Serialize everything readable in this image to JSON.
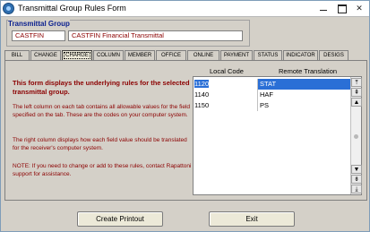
{
  "window": {
    "title": "Transmittal Group Rules Form"
  },
  "group": {
    "title": "Transmittal Group",
    "code": "CASTFIN",
    "name": "CASTFIN Financial Transmittal"
  },
  "tabs": [
    {
      "label": "BILL"
    },
    {
      "label": "CHANGE"
    },
    {
      "label": "CHARGE",
      "active": true
    },
    {
      "label": "COLUMN"
    },
    {
      "label": "MEMBER"
    },
    {
      "label": "OFFICE"
    },
    {
      "label": "ONLINE"
    },
    {
      "label": "PAYMENT"
    },
    {
      "label": "STATUS"
    },
    {
      "label": "INDICATOR"
    },
    {
      "label": "DESIGS"
    }
  ],
  "info": {
    "heading": "This form displays the underlying rules for the selected transmittal group.",
    "p1": "The left column on each tab contains all allowable values for the field specified on the tab. These are the codes on your computer system.",
    "p2": "The right column displays how each field value should be translated for the receiver's computer system.",
    "p3": "NOTE: If you need to change or add to these rules, contact Rapattoni support for assistance."
  },
  "grid": {
    "headers": {
      "local": "Local Code",
      "remote": "Remote Translation"
    },
    "rows": [
      {
        "local": "1120",
        "remote": "STAT",
        "selected": true
      },
      {
        "local": "1140",
        "remote": "HAF"
      },
      {
        "local": "1150",
        "remote": "PS"
      }
    ]
  },
  "buttons": {
    "print": "Create Printout",
    "exit": "Exit"
  },
  "icons": {
    "app": "app-icon",
    "minimize": "minimize-icon",
    "maximize": "maximize-icon",
    "close": "close-icon",
    "scroll": [
      "scroll-top-icon",
      "scroll-page-up-icon",
      "scroll-up-icon",
      "scroll-down-icon",
      "scroll-page-down-icon",
      "scroll-bottom-icon"
    ]
  },
  "colors": {
    "accent_text": "#8b0000",
    "group_title": "#0a1f8f",
    "selection": "#2a6fd6"
  }
}
